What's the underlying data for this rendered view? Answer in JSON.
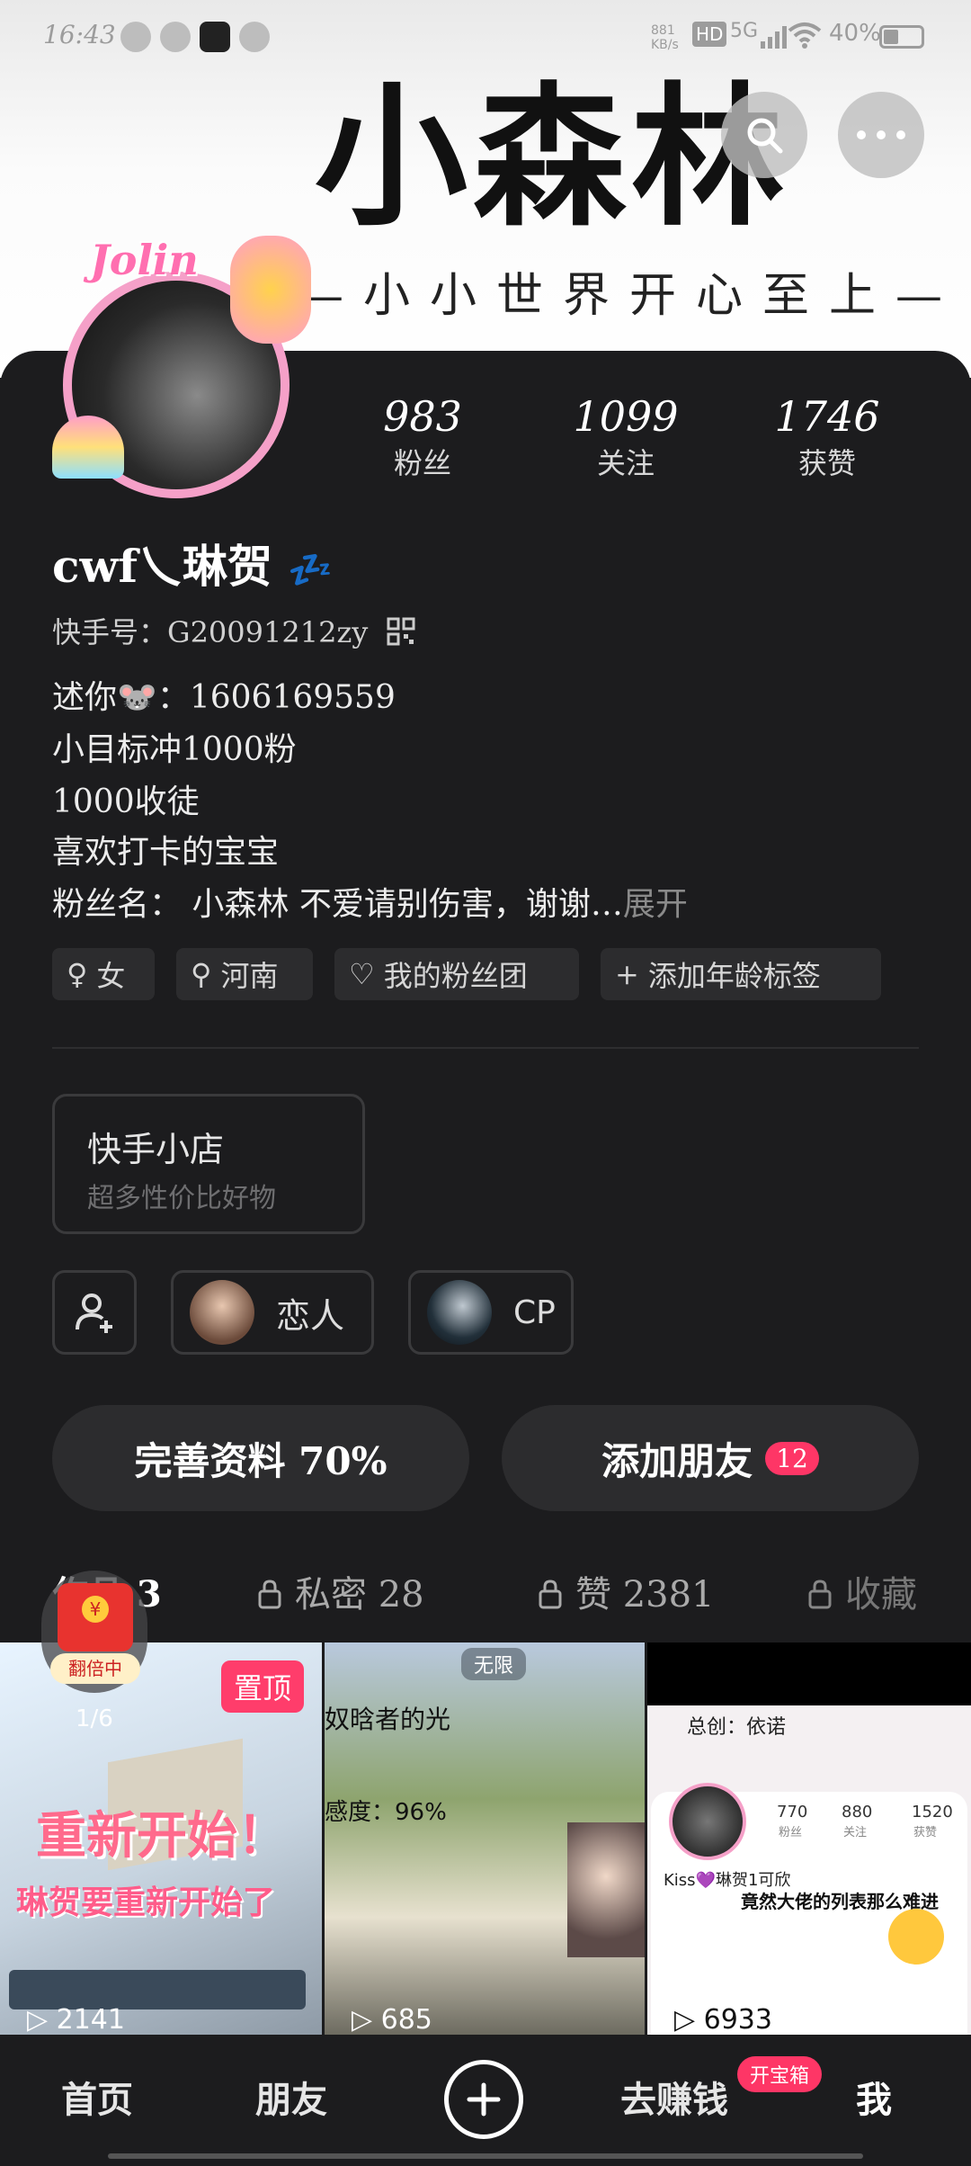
{
  "status_bar": {
    "time": "16:43",
    "net_speed": "881 KB/s",
    "hd": "HD",
    "signal": "5G",
    "battery": "40%"
  },
  "banner": {
    "title": "小森林",
    "subtitle": "—小小世界开心至上—"
  },
  "header_buttons": {
    "search_icon": "search-icon",
    "more_icon": "more-icon"
  },
  "avatar": {
    "badge_text": "Jolin"
  },
  "stats": [
    {
      "value": "983",
      "label": "粉丝"
    },
    {
      "value": "1099",
      "label": "关注"
    },
    {
      "value": "1746",
      "label": "获赞"
    }
  ],
  "profile": {
    "name": "cwf乀琳贺",
    "name_emoji": "💤",
    "kuaishou_id": "快手号：G20091212zy",
    "bio_lines": [
      "述你🐭：1606169559",
      "小目标冲1000粉",
      "1000收徒",
      "喜欢打卡的宝宝",
      "粉丝名：   小森林 不爱请别伤害，谢谢…"
    ],
    "expand_label": "展开"
  },
  "tags": [
    {
      "icon": "♀",
      "label": "女"
    },
    {
      "icon": "⚲",
      "label": "河南"
    },
    {
      "icon": "♡",
      "label": "我的粉丝团"
    },
    {
      "icon": "+",
      "label": "添加年龄标签"
    }
  ],
  "shop": {
    "title": "快手小店",
    "subtitle": "超多性价比好物"
  },
  "relation_chips": [
    {
      "label": "恋人"
    },
    {
      "label": "CP"
    }
  ],
  "actions": {
    "complete_profile": "完善资料 70%",
    "add_friends": "添加朋友",
    "add_friends_badge": "12"
  },
  "content_tabs": [
    {
      "label": "作品 3"
    },
    {
      "label": "私密 28"
    },
    {
      "label": "赞 2381"
    },
    {
      "label": "收藏"
    }
  ],
  "red_packet": {
    "label": "翻倍中"
  },
  "videos": [
    {
      "pinned_label": "置顶",
      "page": "1/6",
      "headline": "重新开始！",
      "caption": "琳贺要重新开始了",
      "plays": "2141"
    },
    {
      "top_label": "无限",
      "caption_top": "奴晗者的光",
      "caption_mid": "感度：96%",
      "plays": "685"
    },
    {
      "title": "总创：依诺",
      "preview_stats": [
        "770",
        "880",
        "1520"
      ],
      "preview_stat_labels": [
        "粉丝",
        "关注",
        "获赞"
      ],
      "preview_name": "Kiss💜琳贺1可欣",
      "caption": "竟然大佬的列表那么难进",
      "plays": "6933"
    }
  ],
  "bottom_nav": [
    {
      "label": "首页"
    },
    {
      "label": "朋友"
    },
    {
      "label": "去赚钱",
      "badge": "开宝箱"
    },
    {
      "label": "我"
    }
  ]
}
